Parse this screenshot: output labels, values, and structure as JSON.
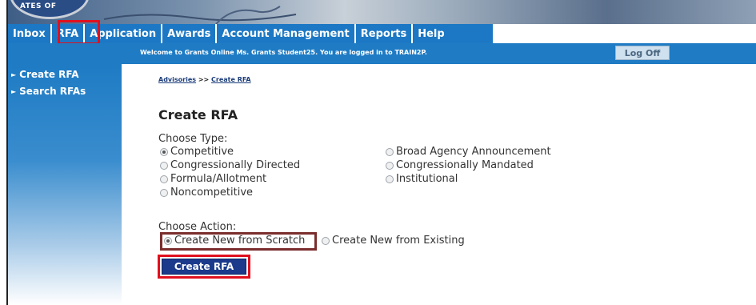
{
  "banner": {
    "seal_text": "ATES OF"
  },
  "nav": {
    "tabs": [
      "Inbox",
      "RFA",
      "Application",
      "Awards",
      "Account Management",
      "Reports",
      "Help"
    ]
  },
  "header": {
    "welcome": "Welcome to Grants Online Ms. Grants Student25. You are logged in to TRAIN2P.",
    "logoff": "Log Off"
  },
  "sidebar": {
    "items": [
      {
        "label": "Create RFA"
      },
      {
        "label": "Search RFAs"
      }
    ]
  },
  "breadcrumb": {
    "advisories": "Advisories",
    "separator": ">>",
    "current": "Create RFA"
  },
  "main": {
    "title": "Create RFA",
    "type_label": "Choose Type:",
    "types": [
      {
        "label": "Competitive",
        "checked": true
      },
      {
        "label": "Congressionally Directed",
        "checked": false
      },
      {
        "label": "Formula/Allotment",
        "checked": false
      },
      {
        "label": "Noncompetitive",
        "checked": false
      },
      {
        "label": "Broad Agency Announcement",
        "checked": false
      },
      {
        "label": "Congressionally Mandated",
        "checked": false
      },
      {
        "label": "Institutional",
        "checked": false
      }
    ],
    "action_label": "Choose Action:",
    "actions": [
      {
        "label": "Create New from Scratch",
        "checked": true
      },
      {
        "label": "Create New from Existing",
        "checked": false
      }
    ],
    "submit": "Create RFA"
  },
  "colors": {
    "nav_blue": "#1c78c4",
    "button_navy": "#1b3a8c",
    "highlight_red": "#e0101e",
    "highlight_maroon": "#7b2d2d"
  }
}
